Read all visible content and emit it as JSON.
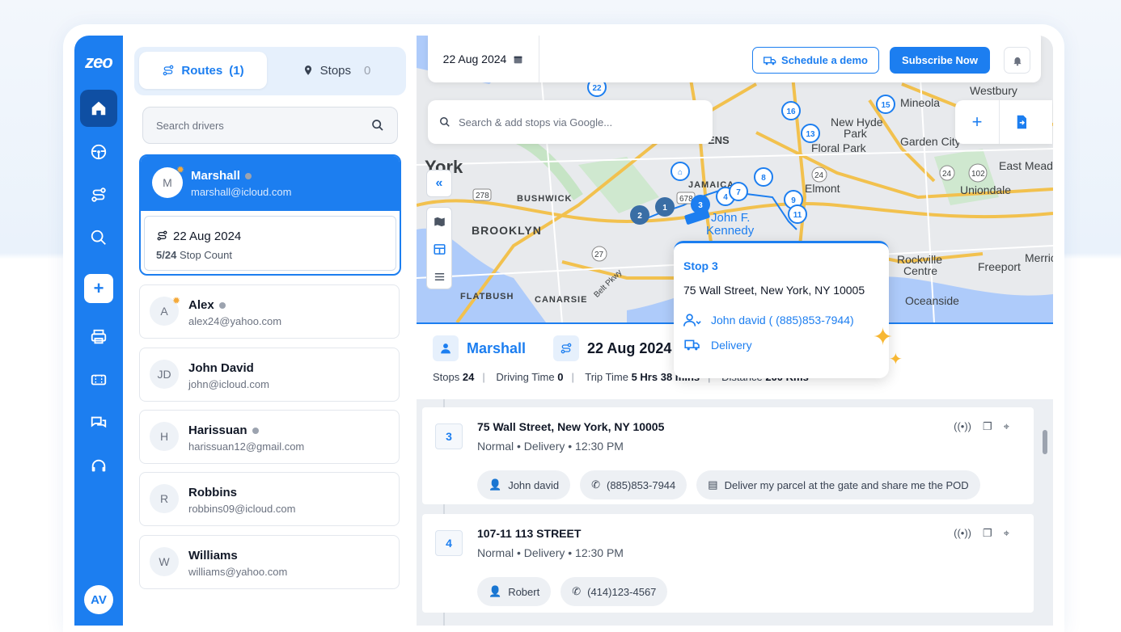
{
  "app": {
    "logo": "zeo",
    "user_initials": "AV"
  },
  "tabs": {
    "routes_label": "Routes",
    "routes_count": "(1)",
    "stops_label": "Stops",
    "stops_count": "0"
  },
  "search": {
    "placeholder": "Search drivers"
  },
  "selected_driver": {
    "initial": "M",
    "name": "Marshall",
    "email": "marshall@icloud.com",
    "route_date": "22 Aug 2024",
    "stop_count_value": "5/24",
    "stop_count_label": "Stop Count"
  },
  "drivers": [
    {
      "initial": "A",
      "name": "Alex",
      "email": "alex24@yahoo.com"
    },
    {
      "initial": "JD",
      "name": "John David",
      "email": "john@icloud.com"
    },
    {
      "initial": "H",
      "name": "Harissuan",
      "email": "harissuan12@gmail.com"
    },
    {
      "initial": "R",
      "name": "Robbins",
      "email": "robbins09@icloud.com"
    },
    {
      "initial": "W",
      "name": "Williams",
      "email": "williams@yahoo.com"
    }
  ],
  "topbar": {
    "date": "22 Aug 2024",
    "demo_label": "Schedule a demo",
    "subscribe_label": "Subscribe Now"
  },
  "map": {
    "search_placeholder": "Search & add stops via Google...",
    "places": [
      "York",
      "BUSHWICK",
      "BROOKLYN",
      "FLATBUSH",
      "CANARSIE",
      "JAMAICA",
      "John F. Kennedy",
      "Mineola",
      "Westbury",
      "New Hyde Park",
      "Floral Park",
      "Garden City",
      "East Meadow",
      "Elmont",
      "Uniondale",
      "Rockville Centre",
      "Freeport",
      "Merric",
      "Oceanside",
      "ENS",
      "Belt Pkwy"
    ],
    "pins": [
      "1",
      "2",
      "3",
      "4",
      "7",
      "8",
      "9",
      "11",
      "13",
      "15",
      "16",
      "22"
    ],
    "roads": [
      "278",
      "678",
      "27",
      "24",
      "102"
    ]
  },
  "popup": {
    "title": "Stop 3",
    "address": "75 Wall Street, New York, NY 10005",
    "contact": "John david ( (885)853-7944)",
    "type": "Delivery"
  },
  "summary": {
    "driver": "Marshall",
    "date": "22 Aug 2024",
    "stops_label": "Stops",
    "stops_value": "24",
    "driving_label": "Driving Time",
    "driving_value": "0",
    "trip_label": "Trip Time",
    "trip_value": "5 Hrs 38 mins",
    "distance_label": "Distance",
    "distance_value": "200 Kms"
  },
  "stops": [
    {
      "num": "3",
      "address": "75 Wall Street, New York, NY 10005",
      "meta": "Normal • Delivery • 12:30 PM",
      "contact": "John david",
      "phone": "(885)853-7944",
      "note": "Deliver my parcel at the gate and share me the POD"
    },
    {
      "num": "4",
      "address": "107-11 113 STREET",
      "meta": "Normal • Delivery • 12:30 PM",
      "contact": "Robert",
      "phone": "(414)123-4567"
    }
  ],
  "colors": {
    "primary": "#1c7ef0",
    "rail_active": "#0f4fa3",
    "road": "#f2c14e"
  }
}
